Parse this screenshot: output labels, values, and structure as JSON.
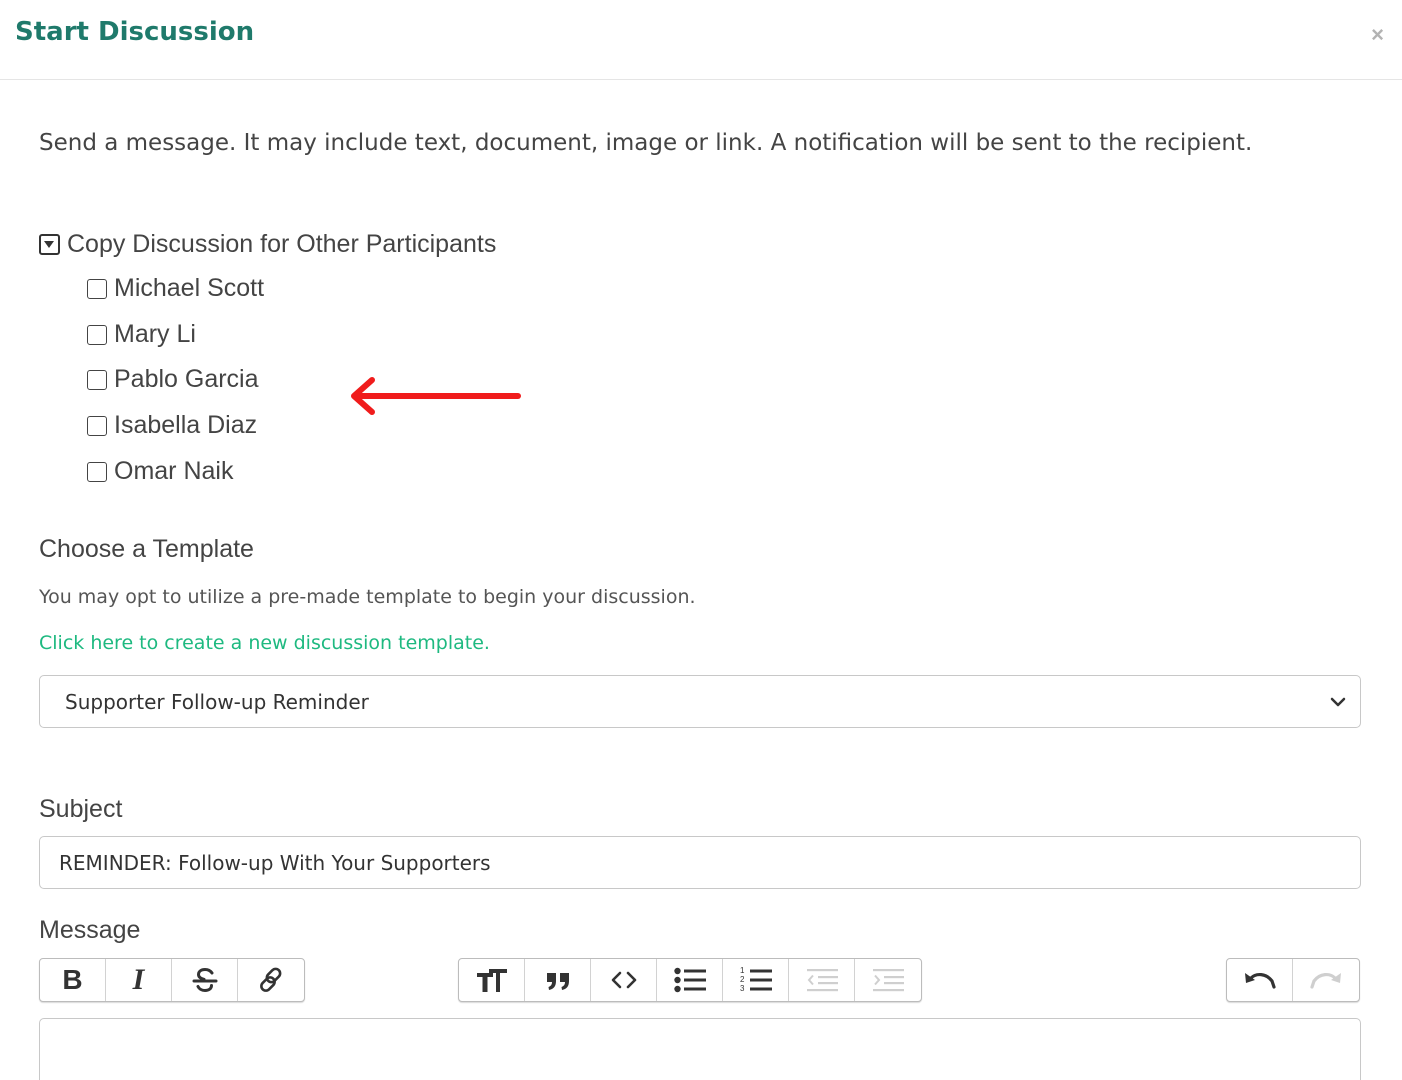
{
  "modal": {
    "title": "Start Discussion",
    "close_label": "×"
  },
  "intro_text": "Send a message. It may include text, document, image or link. A notification will be sent to the recipient.",
  "copy_section": {
    "label": "Copy Discussion for Other Participants",
    "participants": [
      {
        "name": "Michael Scott",
        "checked": false
      },
      {
        "name": "Mary Li",
        "checked": false
      },
      {
        "name": "Pablo Garcia",
        "checked": false
      },
      {
        "name": "Isabella Diaz",
        "checked": false
      },
      {
        "name": "Omar Naik",
        "checked": false
      }
    ]
  },
  "template_section": {
    "title": "Choose a Template",
    "help_text": "You may opt to utilize a pre-made template to begin your discussion.",
    "create_link": "Click here to create a new discussion template.",
    "selected_template": "Supporter Follow-up Reminder"
  },
  "subject": {
    "label": "Subject",
    "value": "REMINDER: Follow-up With Your Supporters"
  },
  "message": {
    "label": "Message",
    "toolbar": {
      "bold_label": "B",
      "italic_label": "I"
    }
  },
  "colors": {
    "title": "#1f7a6b",
    "link": "#1eb980",
    "arrow": "#f01c1c"
  }
}
